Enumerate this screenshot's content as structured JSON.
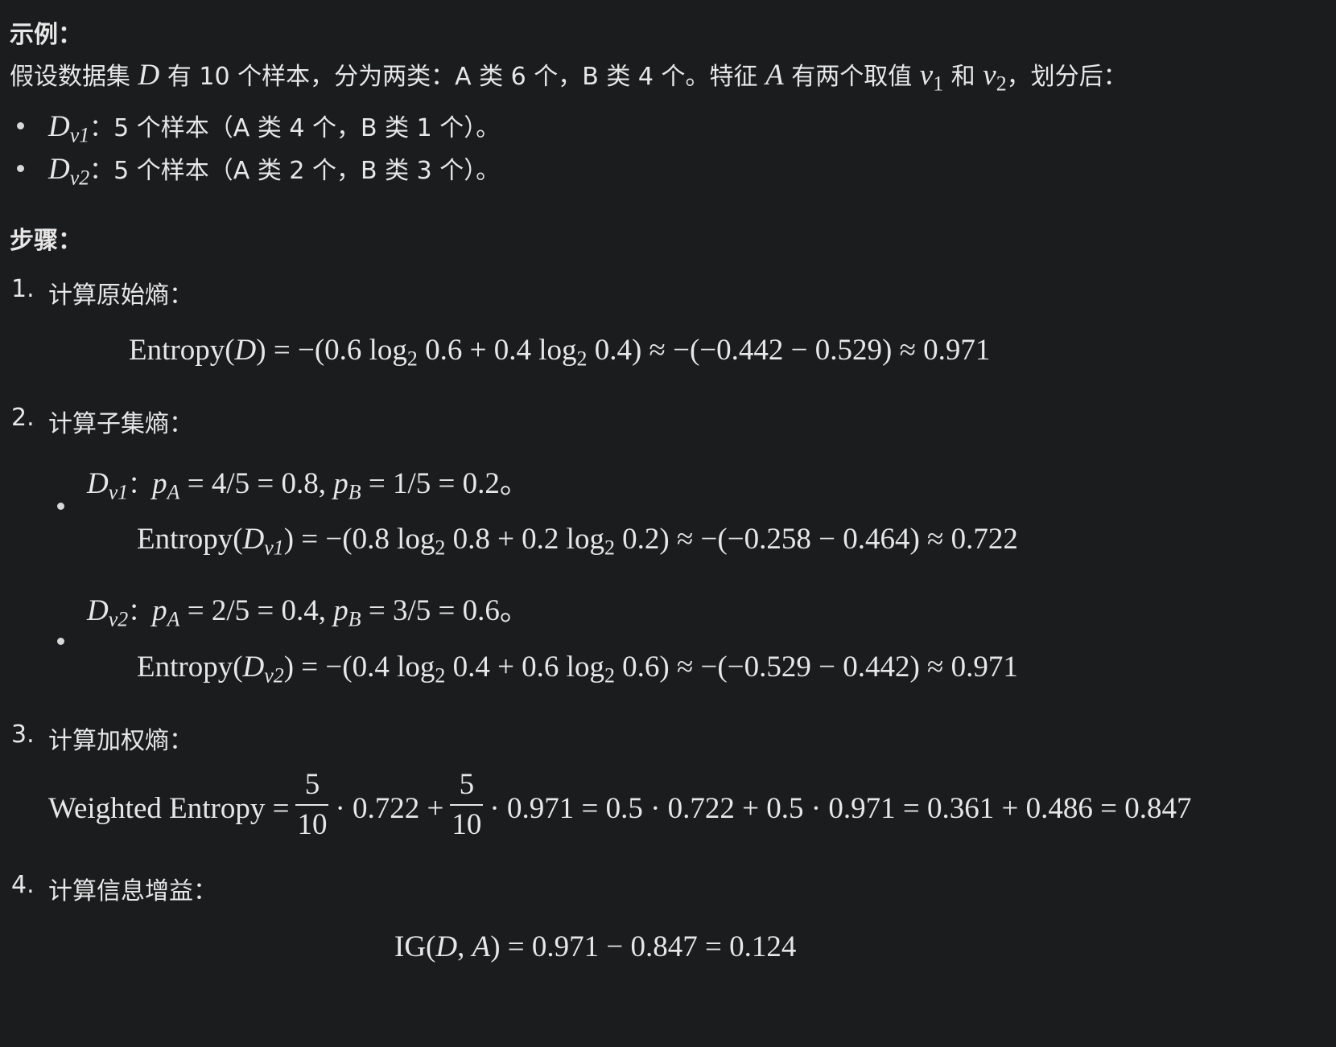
{
  "example": {
    "heading": "示例：",
    "intro": {
      "t1": "假设数据集 ",
      "D": "D",
      "t2": " 有 10 个样本，分为两类：A 类 6 个，B 类 4 个。特征 ",
      "A": "A",
      "t3": " 有两个取值 ",
      "v": "v",
      "one": "1",
      "and": " 和 ",
      "two": "2",
      "t4": "，划分后："
    },
    "items": [
      {
        "D": "D",
        "sub": "v1",
        "text": "：5 个样本（A 类 4 个，B 类 1 个）。"
      },
      {
        "D": "D",
        "sub": "v2",
        "text": "：5 个样本（A 类 2 个，B 类 3 个）。"
      }
    ]
  },
  "steps": {
    "heading": "步骤：",
    "step1": {
      "number": "1.",
      "label": "计算原始熵：",
      "formula": {
        "a": "Entropy(",
        "D": "D",
        "b": ") = −(0.6 log",
        "s1": "2",
        "c": " 0.6 + 0.4 log",
        "s2": "2",
        "d": " 0.4) ≈ −(−0.442 − 0.529) ≈ 0.971"
      }
    },
    "step2": {
      "number": "2.",
      "label": "计算子集熵：",
      "subs": [
        {
          "D": "D",
          "sub": "v1",
          "colon": "：",
          "pA": "p",
          "pA_sub": "A",
          "pA_val": " = 4/5 = 0.8, ",
          "pB": "p",
          "pB_sub": "B",
          "pB_val": " = 1/5 = 0.2。",
          "formula": {
            "a": "Entropy(",
            "D": "D",
            "sub": "v1",
            "b": ") = −(0.8 log",
            "s1": "2",
            "c": " 0.8 + 0.2 log",
            "s2": "2",
            "d": " 0.2) ≈ −(−0.258 − 0.464) ≈ 0.722"
          }
        },
        {
          "D": "D",
          "sub": "v2",
          "colon": "：",
          "pA": "p",
          "pA_sub": "A",
          "pA_val": " = 2/5 = 0.4, ",
          "pB": "p",
          "pB_sub": "B",
          "pB_val": " = 3/5 = 0.6。",
          "formula": {
            "a": "Entropy(",
            "D": "D",
            "sub": "v2",
            "b": ") = −(0.4 log",
            "s1": "2",
            "c": " 0.4 + 0.6 log",
            "s2": "2",
            "d": " 0.6) ≈ −(−0.529 − 0.442) ≈ 0.971"
          }
        }
      ]
    },
    "step3": {
      "number": "3.",
      "label": "计算加权熵：",
      "formula": {
        "lhs": "Weighted Entropy =",
        "f1_num": "5",
        "f1_den": "10",
        "mid": "· 0.722 +",
        "f2_num": "5",
        "f2_den": "10",
        "rest": "· 0.971 = 0.5 · 0.722 + 0.5 · 0.971 = 0.361 + 0.486 = 0.847"
      }
    },
    "step4": {
      "number": "4.",
      "label": "计算信息增益：",
      "formula": {
        "a": "IG(",
        "D": "D",
        "comma": ", ",
        "A": "A",
        "b": ") = 0.971 − 0.847 = 0.124"
      }
    }
  }
}
